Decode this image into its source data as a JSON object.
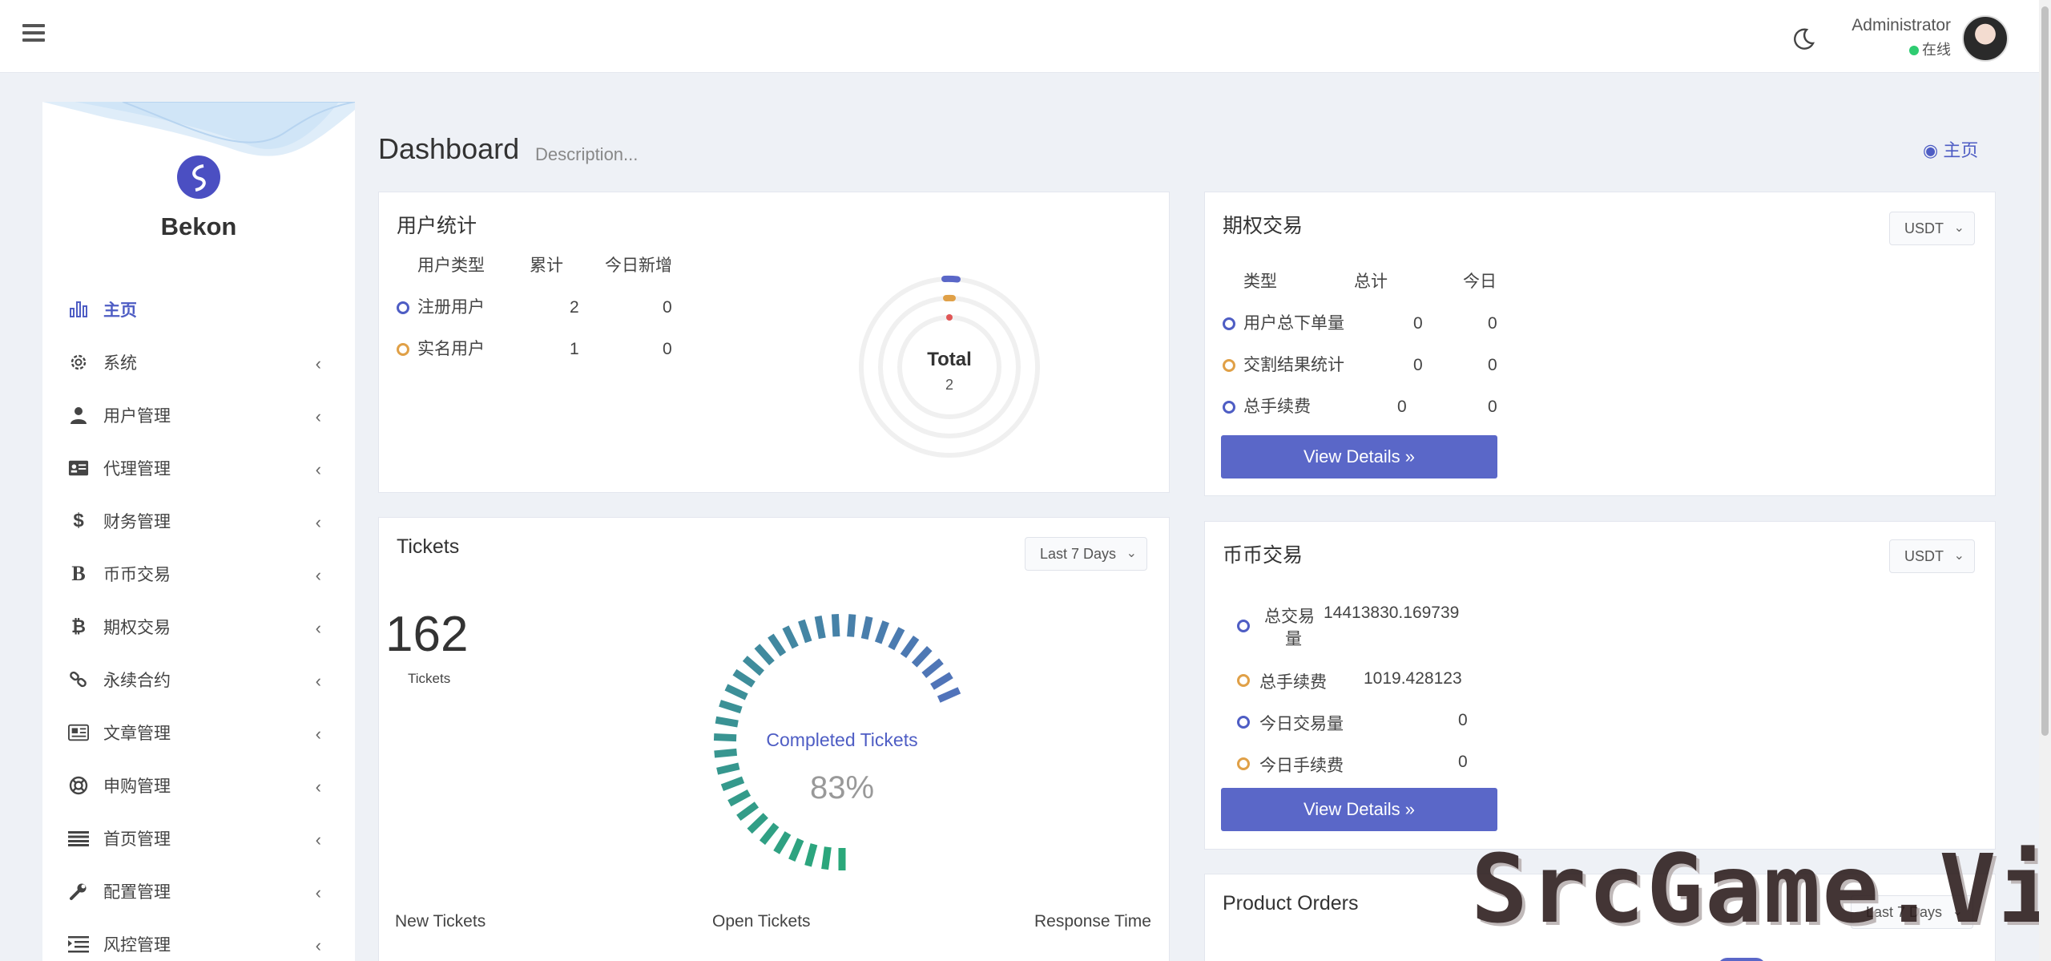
{
  "header": {
    "user_name": "Administrator",
    "user_status": "在线"
  },
  "sidebar": {
    "brand": "Bekon",
    "items": [
      {
        "label": "主页",
        "icon": "bar-chart-icon",
        "active": true
      },
      {
        "label": "系统",
        "icon": "gear-icon"
      },
      {
        "label": "用户管理",
        "icon": "user-icon"
      },
      {
        "label": "代理管理",
        "icon": "id-card-icon"
      },
      {
        "label": "财务管理",
        "icon": "dollar-icon"
      },
      {
        "label": "币币交易",
        "icon": "bold-b-icon"
      },
      {
        "label": "期权交易",
        "icon": "bitcoin-icon"
      },
      {
        "label": "永续合约",
        "icon": "link-icon"
      },
      {
        "label": "文章管理",
        "icon": "newspaper-icon"
      },
      {
        "label": "申购管理",
        "icon": "lifebuoy-icon"
      },
      {
        "label": "首页管理",
        "icon": "list-icon"
      },
      {
        "label": "配置管理",
        "icon": "wrench-icon"
      },
      {
        "label": "风控管理",
        "icon": "indent-icon"
      }
    ]
  },
  "page": {
    "title": "Dashboard",
    "description": "Description...",
    "breadcrumb": "主页"
  },
  "user_stats": {
    "title": "用户统计",
    "headers": [
      "用户类型",
      "累计",
      "今日新增"
    ],
    "rows": [
      {
        "type": "注册用户",
        "total": "2",
        "today": "0"
      },
      {
        "type": "实名用户",
        "total": "1",
        "today": "0"
      }
    ],
    "donut_label": "Total",
    "donut_value": "2"
  },
  "options_trading": {
    "title": "期权交易",
    "currency": "USDT",
    "headers": [
      "类型",
      "总计",
      "今日"
    ],
    "rows": [
      {
        "type": "用户总下单量",
        "total": "0",
        "today": "0"
      },
      {
        "type": "交割结果统计",
        "total": "0",
        "today": "0"
      },
      {
        "type": "总手续费",
        "total": "0",
        "today": "0"
      }
    ],
    "button": "View Details"
  },
  "tickets": {
    "title": "Tickets",
    "range": "Last 7 Days",
    "count": "162",
    "count_label": "Tickets",
    "gauge_label": "Completed Tickets",
    "gauge_value": "83%",
    "gauge_fraction": 0.83,
    "footer": [
      "New Tickets",
      "Open Tickets",
      "Response Time"
    ]
  },
  "spot_trading": {
    "title": "币币交易",
    "currency": "USDT",
    "rows": [
      {
        "label_line1": "总交易",
        "label_line2": "量",
        "value": "14413830.169739"
      },
      {
        "label": "总手续费",
        "value": "1019.428123"
      },
      {
        "label": "今日交易量",
        "value": "0"
      },
      {
        "label": "今日手续费",
        "value": "0"
      }
    ],
    "button": "View Details"
  },
  "product_orders": {
    "title": "Product Orders",
    "range": "Last 7 Days"
  },
  "watermark": "SrcGame.Vip",
  "colors": {
    "accent": "#5a67c8",
    "green": "#2aa87a",
    "orange": "#e0a047",
    "red": "#e05555"
  }
}
